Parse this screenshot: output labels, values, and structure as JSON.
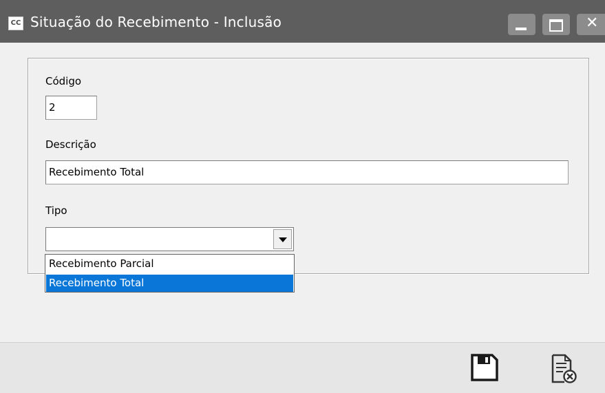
{
  "window": {
    "app_icon": "CC",
    "title": "Situação do Recebimento - Inclusão",
    "controls": {
      "minimize": "minimize-icon",
      "maximize": "maximize-icon",
      "close": "close-icon"
    }
  },
  "form": {
    "codigo": {
      "label": "Código",
      "value": "2"
    },
    "descricao": {
      "label": "Descrição",
      "value": "Recebimento Total"
    },
    "tipo": {
      "label": "Tipo",
      "value": "",
      "options": [
        "Recebimento Parcial",
        "Recebimento Total"
      ],
      "highlighted": "Recebimento Total"
    }
  },
  "footer": {
    "save_icon": "save-icon",
    "cancel_icon": "cancel-document-icon"
  },
  "colors": {
    "titlebar": "#5e5e5e",
    "selection": "#0a77d8",
    "background": "#f0f0f0"
  }
}
